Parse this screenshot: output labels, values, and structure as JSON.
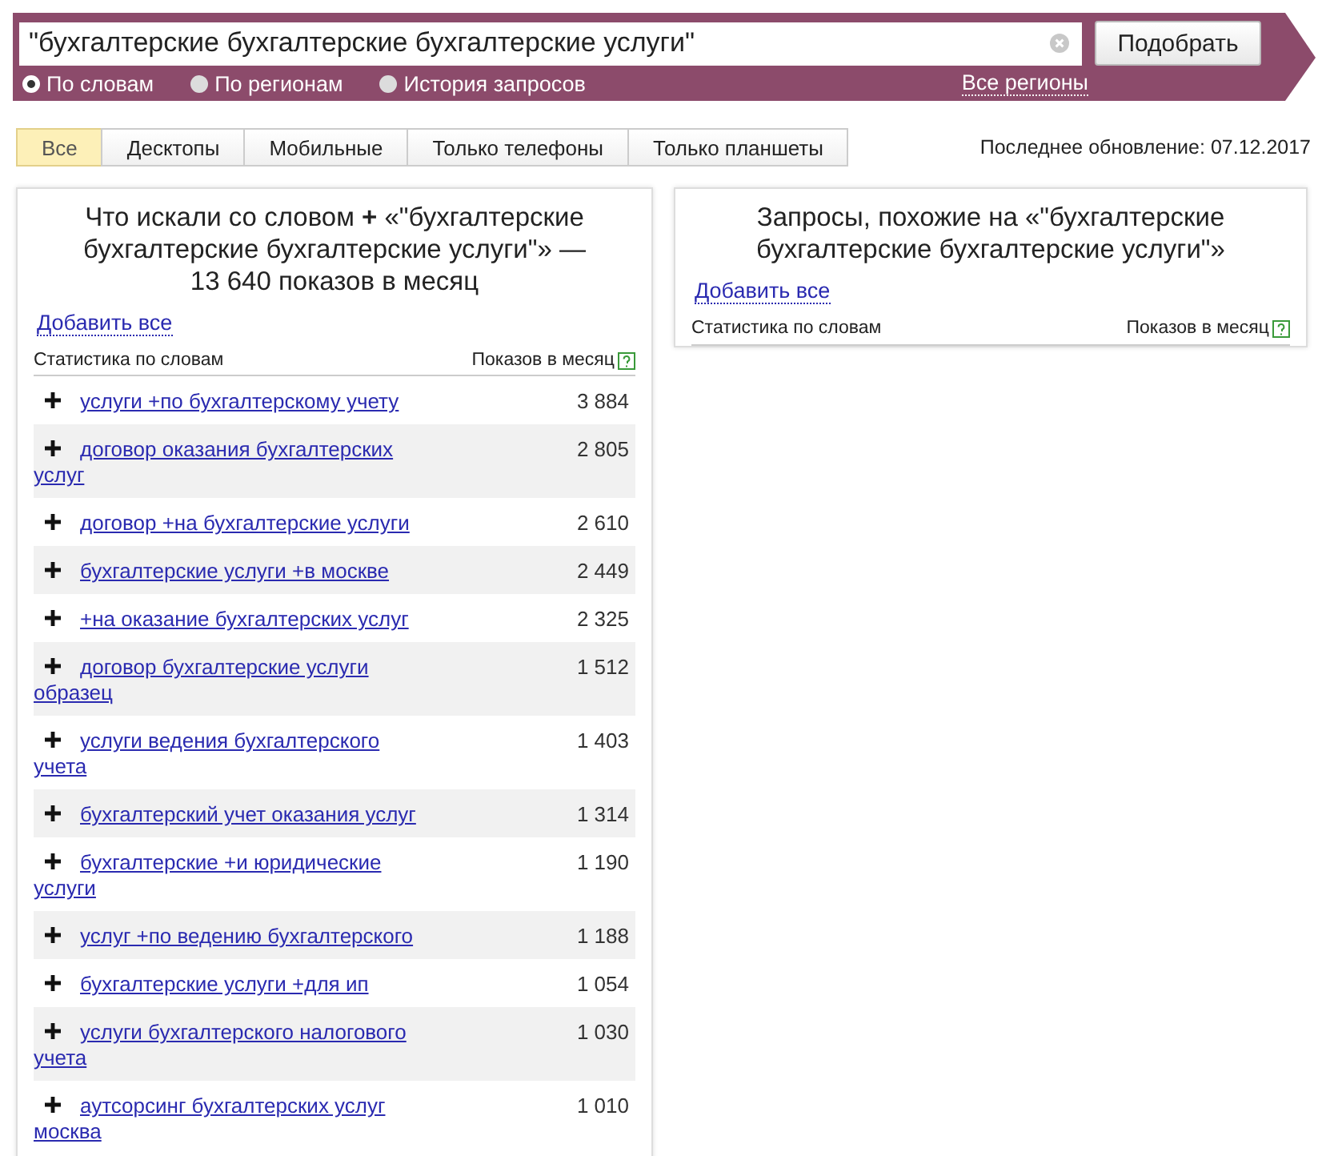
{
  "search": {
    "value": "\"бухгалтерские бухгалтерские бухгалтерские услуги\"",
    "button": "Подобрать"
  },
  "modes": [
    {
      "label": "По словам",
      "selected": true
    },
    {
      "label": "По регионам",
      "selected": false
    },
    {
      "label": "История запросов",
      "selected": false
    }
  ],
  "regions_link": "Все регионы",
  "tabs": [
    {
      "label": "Все",
      "selected": true
    },
    {
      "label": "Десктопы",
      "selected": false
    },
    {
      "label": "Мобильные",
      "selected": false
    },
    {
      "label": "Только телефоны",
      "selected": false
    },
    {
      "label": "Только планшеты",
      "selected": false
    }
  ],
  "last_update": "Последнее обновление: 07.12.2017",
  "left_panel": {
    "title": "Что искали со словом **+** «\"бухгалтерские бухгалтерские бухгалтерские услуги\"» — 13 640 показов в месяц",
    "add_all": "Добавить все",
    "columns": [
      "Статистика по словам",
      "Показов в месяц"
    ],
    "rows": [
      {
        "phrase": "услуги +по бухгалтерскому учету",
        "count": "3 884"
      },
      {
        "phrase": "договор оказания бухгалтерских услуг",
        "count": "2 805"
      },
      {
        "phrase": "договор +на бухгалтерские услуги",
        "count": "2 610"
      },
      {
        "phrase": "бухгалтерские услуги +в москве",
        "count": "2 449"
      },
      {
        "phrase": "+на оказание бухгалтерских услуг",
        "count": "2 325"
      },
      {
        "phrase": "договор бухгалтерские услуги образец",
        "count": "1 512"
      },
      {
        "phrase": "услуги ведения бухгалтерского учета",
        "count": "1 403"
      },
      {
        "phrase": "бухгалтерский учет оказания услуг",
        "count": "1 314"
      },
      {
        "phrase": "бухгалтерские +и юридические услуги",
        "count": "1 190"
      },
      {
        "phrase": "услуг +по ведению бухгалтерского",
        "count": "1 188"
      },
      {
        "phrase": "бухгалтерские услуги +для ип",
        "count": "1 054"
      },
      {
        "phrase": "услуги бухгалтерского налогового учета",
        "count": "1 030"
      },
      {
        "phrase": "аутсорсинг бухгалтерских услуг москва",
        "count": "1 010"
      }
    ]
  },
  "right_panel": {
    "title": "Запросы, похожие на «\"бухгалтерские бухгалтерские бухгалтерские услуги\"»",
    "add_all": "Добавить все",
    "columns": [
      "Статистика по словам",
      "Показов в месяц"
    ]
  }
}
